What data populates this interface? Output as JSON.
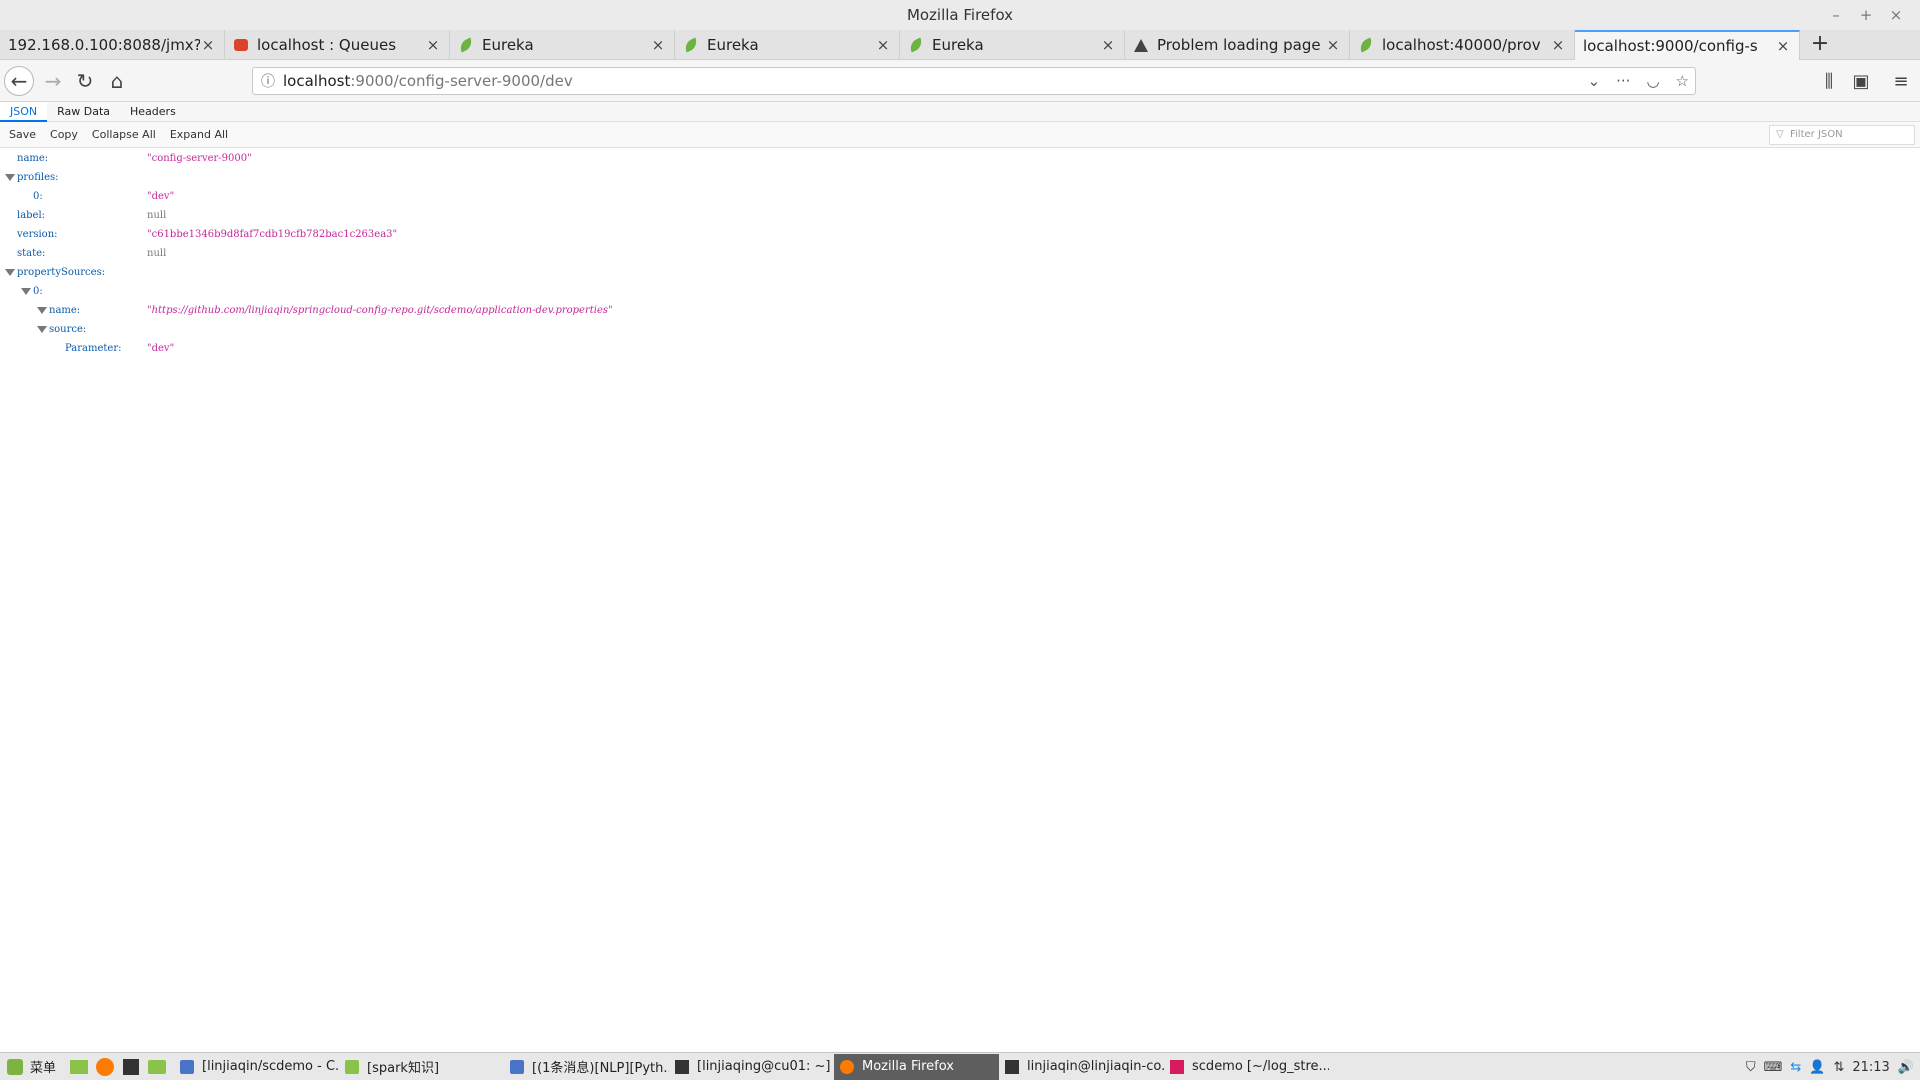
{
  "window": {
    "title": "Mozilla Firefox"
  },
  "tabs": [
    {
      "label": "192.168.0.100:8088/jmx?",
      "icon": "none"
    },
    {
      "label": "localhost : Queues",
      "icon": "rabbitmq-icon"
    },
    {
      "label": "Eureka",
      "icon": "spring-leaf-icon"
    },
    {
      "label": "Eureka",
      "icon": "spring-leaf-icon"
    },
    {
      "label": "Eureka",
      "icon": "spring-leaf-icon"
    },
    {
      "label": "Problem loading page",
      "icon": "warning-icon"
    },
    {
      "label": "localhost:40000/prov",
      "icon": "spring-leaf-icon"
    },
    {
      "label": "localhost:9000/config-s",
      "icon": "none"
    }
  ],
  "urlbar": {
    "host": "localhost",
    "rest": ":9000/config-server-9000/dev"
  },
  "viewer": {
    "tabs": [
      "JSON",
      "Raw Data",
      "Headers"
    ],
    "toolbar": [
      "Save",
      "Copy",
      "Collapse All",
      "Expand All"
    ],
    "filter_placeholder": "Filter JSON"
  },
  "json_tree": [
    {
      "key": "name:",
      "value": "\"config-server-9000\"",
      "kind": "string",
      "depth": 0,
      "twisty": false
    },
    {
      "key": "profiles:",
      "value": "",
      "kind": "",
      "depth": 0,
      "twisty": true
    },
    {
      "key": "0:",
      "value": "\"dev\"",
      "kind": "string",
      "depth": 1,
      "twisty": false
    },
    {
      "key": "label:",
      "value": "null",
      "kind": "null",
      "depth": 0,
      "twisty": false
    },
    {
      "key": "version:",
      "value": "\"c61bbe1346b9d8faf7cdb19cfb782bac1c263ea3\"",
      "kind": "string",
      "depth": 0,
      "twisty": false
    },
    {
      "key": "state:",
      "value": "null",
      "kind": "null",
      "depth": 0,
      "twisty": false
    },
    {
      "key": "propertySources:",
      "value": "",
      "kind": "",
      "depth": 0,
      "twisty": true
    },
    {
      "key": "0:",
      "value": "",
      "kind": "",
      "depth": 1,
      "twisty": true
    },
    {
      "key": "name:",
      "value": "\"https://github.com/linjiaqin/springcloud-config-repo.git/scdemo/application-dev.properties\"",
      "kind": "link",
      "depth": 2,
      "twisty": true
    },
    {
      "key": "source:",
      "value": "",
      "kind": "",
      "depth": 2,
      "twisty": true
    },
    {
      "key": "Parameter:",
      "value": "\"dev\"",
      "kind": "string",
      "depth": 3,
      "twisty": false
    }
  ],
  "taskbar": {
    "menu_label": "菜单",
    "tasks": [
      {
        "label": "[linjiaqin/scdemo - C...",
        "active": false
      },
      {
        "label": "[spark知识]",
        "active": false
      },
      {
        "label": "[(1条消息)[NLP][Pyth...",
        "active": false
      },
      {
        "label": "[linjiaqing@cu01: ~]",
        "active": false
      },
      {
        "label": "Mozilla Firefox",
        "active": true
      },
      {
        "label": "linjiaqin@linjiaqin-co...",
        "active": false
      },
      {
        "label": "scdemo [~/log_stre...",
        "active": false
      }
    ],
    "clock": "21:13"
  }
}
